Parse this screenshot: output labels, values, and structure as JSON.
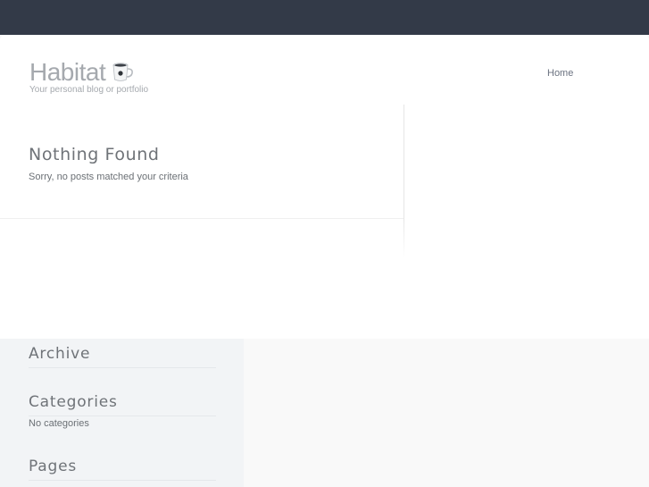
{
  "header": {
    "site_title": "Habitat",
    "tagline": "Your personal blog or portfolio",
    "logo_icon": "coffee-cup-icon"
  },
  "nav": {
    "items": [
      {
        "label": "Home"
      }
    ]
  },
  "main": {
    "title": "Nothing Found",
    "message": "Sorry, no posts matched your criteria"
  },
  "sidebar": {
    "widgets": [
      {
        "title": "Archive",
        "text": ""
      },
      {
        "title": "Categories",
        "text": "No categories"
      },
      {
        "title": "Pages",
        "text": ""
      }
    ]
  },
  "colors": {
    "topbar": "#333a48",
    "page_background": "#ffffff",
    "sidebar_background": "#f2f4f6",
    "text_muted": "#a5a9ae"
  }
}
